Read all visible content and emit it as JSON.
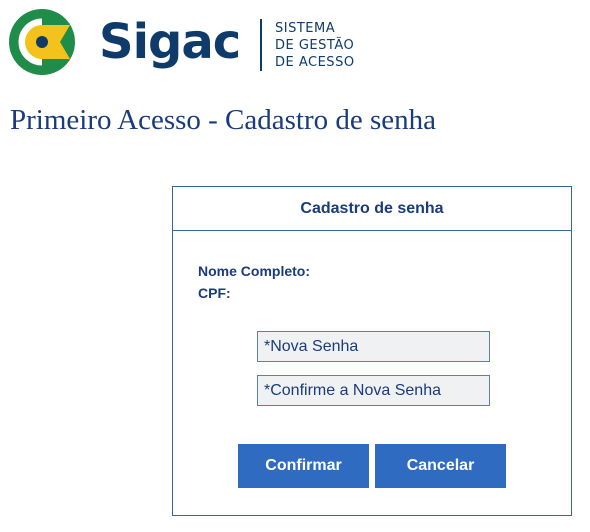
{
  "brand": {
    "name": "Sigac",
    "tagline": [
      "SISTEMA",
      "DE GESTÃO",
      "DE ACESSO"
    ],
    "logo_icon": "sigac-logo-icon",
    "colors": {
      "green": "#1f8c4a",
      "yellow": "#f3c21b",
      "navy": "#0f3b6b"
    }
  },
  "page": {
    "title": "Primeiro Acesso - Cadastro de senha"
  },
  "card": {
    "header": "Cadastro de senha",
    "name_label": "Nome Completo:",
    "cpf_label": "CPF:",
    "new_password_placeholder": "*Nova Senha",
    "confirm_password_placeholder": "*Confirme a Nova Senha",
    "confirm_button": "Confirmar",
    "cancel_button": "Cancelar"
  },
  "colors": {
    "primary_button": "#2f6bc0",
    "text": "#1a3b7c",
    "border": "#3564a6"
  }
}
